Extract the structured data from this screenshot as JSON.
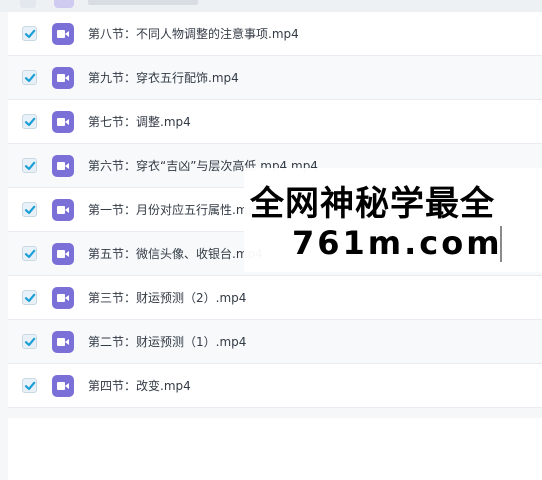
{
  "files": [
    {
      "name": "第八节：不同人物调整的注意事项.mp4",
      "checked": true
    },
    {
      "name": "第九节：穿衣五行配饰.mp4",
      "checked": true
    },
    {
      "name": "第七节：调整.mp4",
      "checked": true
    },
    {
      "name": "第六节：穿衣“吉凶”与层次高低.mp4.mp4",
      "checked": true
    },
    {
      "name": "第一节：月份对应五行属性.mp4",
      "checked": true
    },
    {
      "name": "第五节：微信头像、收银台.mp4",
      "checked": true
    },
    {
      "name": "第三节：财运预测（2）.mp4",
      "checked": true
    },
    {
      "name": "第二节：财运预测（1）.mp4",
      "checked": true
    },
    {
      "name": "第四节：改变.mp4",
      "checked": true
    }
  ],
  "icon": "video-file-icon",
  "colors": {
    "accent": "#7b6fd8",
    "check": "#1e9fd8"
  },
  "watermark": {
    "line1": "全网神秘学最全",
    "line2": "761m.com"
  }
}
